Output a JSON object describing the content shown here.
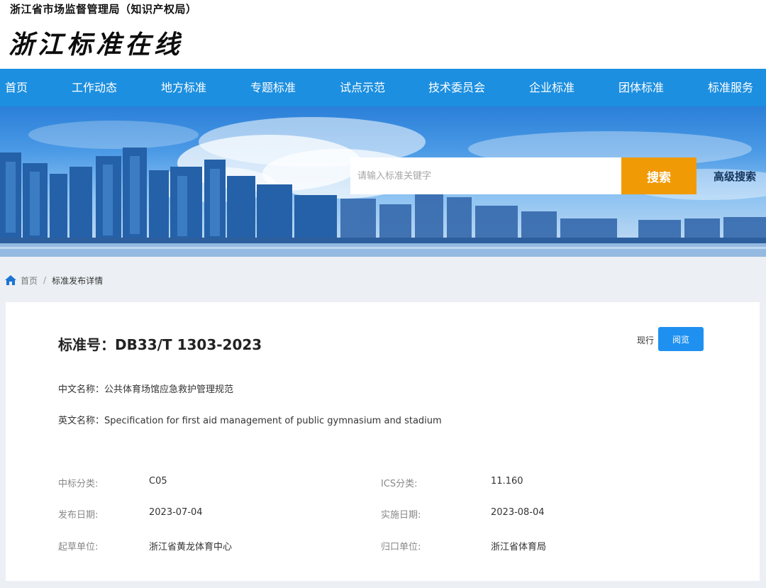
{
  "header": {
    "org_name": "浙江省市场监督管理局（知识产权局）",
    "site_title": "浙江标准在线"
  },
  "nav": {
    "items": [
      "首页",
      "工作动态",
      "地方标准",
      "专题标准",
      "试点示范",
      "技术委员会",
      "企业标准",
      "团体标准",
      "标准服务"
    ]
  },
  "search": {
    "placeholder": "请输入标准关键字",
    "button_label": "搜索",
    "advanced_label": "高级搜索"
  },
  "breadcrumb": {
    "home": "首页",
    "separator": "/",
    "current": "标准发布详情"
  },
  "detail": {
    "standard_number": "标准号：DB33/T 1303-2023",
    "status": "现行",
    "view_button": "阅览",
    "chinese_name_label": "中文名称：",
    "chinese_name": "公共体育场馆应急救护管理规范",
    "english_name_label": "英文名称：",
    "english_name": "Specification for first aid management of public gymnasium and stadium",
    "ccs_label": "中标分类:",
    "ccs_value": "C05",
    "ics_label": "ICS分类:",
    "ics_value": "11.160",
    "publish_label": "发布日期:",
    "publish_value": "2023-07-04",
    "implement_label": "实施日期:",
    "implement_value": "2023-08-04",
    "drafter_label": "起草单位:",
    "drafter_value": "浙江省黄龙体育中心",
    "authority_label": "归口单位:",
    "authority_value": "浙江省体育局"
  },
  "colors": {
    "nav_bg": "#1c8fe0",
    "search_button": "#f09a05",
    "view_button": "#1e90f0",
    "page_bg": "#eceff3"
  },
  "icons": {
    "breadcrumb_home": "home-icon"
  }
}
